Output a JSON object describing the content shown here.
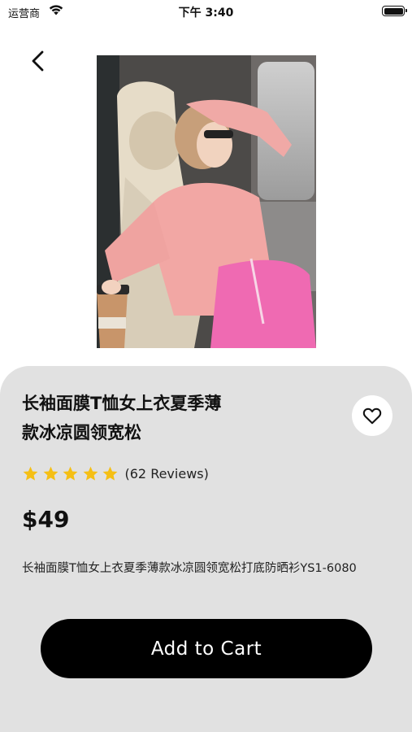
{
  "status_bar": {
    "carrier": "运营商",
    "time": "下午 3:40",
    "wifi_icon": "wifi-icon",
    "battery_icon": "battery-icon"
  },
  "navigation": {
    "back_icon": "chevron-left-icon"
  },
  "product": {
    "image_icon": "product-photo",
    "title": "长袖面膜T恤女上衣夏季薄款冰凉圆领宽松",
    "rating": 5,
    "reviews_label": "(62 Reviews)",
    "price": "$49",
    "description": "长袖面膜T恤女上衣夏季薄款冰凉圆领宽松打底防晒衫YS1-6080",
    "favorite_icon": "heart-outline-icon"
  },
  "actions": {
    "add_to_cart_label": "Add to Cart"
  },
  "colors": {
    "card_background": "#e1e1e1",
    "star": "#f5bf14",
    "button_background": "#000000",
    "button_text": "#ffffff"
  }
}
